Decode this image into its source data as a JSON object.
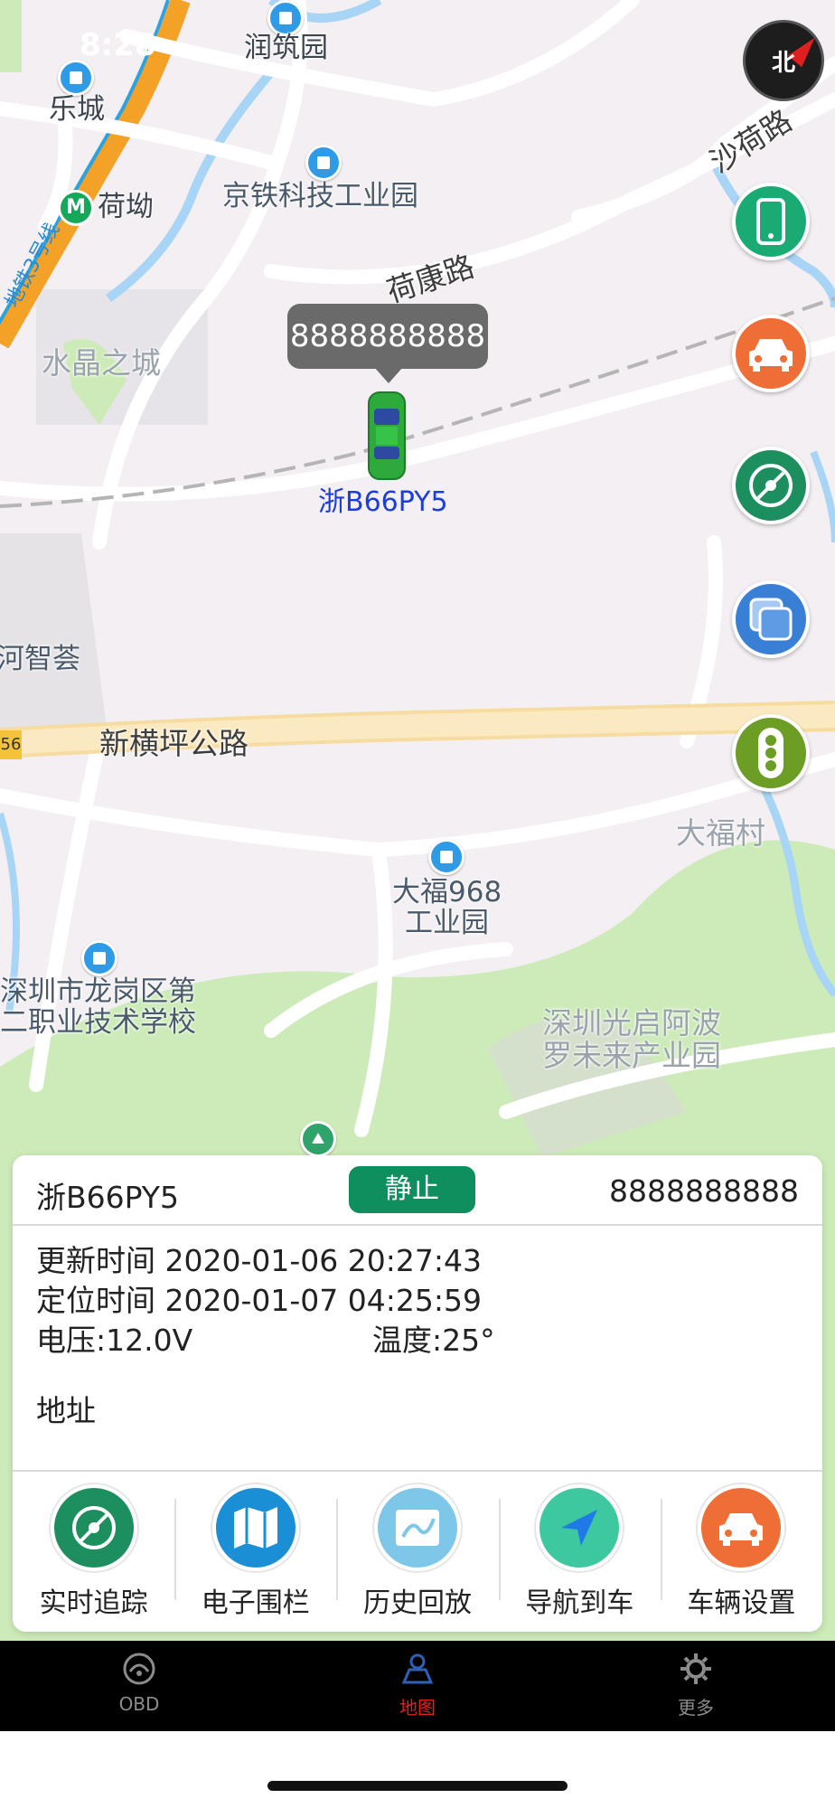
{
  "status_bar": {
    "time": "8:28"
  },
  "map": {
    "compass_label": "北",
    "labels": {
      "runzhu": "润筑园",
      "lecheng": "乐城",
      "heao": "荷坳",
      "jingtie": "京铁科技工业园",
      "shahe_road": "沙荷路",
      "hekang_road": "荷康路",
      "shuijing": "水晶之城",
      "hezhi": "河智荟",
      "xinhengping": "新横坪公路",
      "route_num": "56",
      "dafu_village": "大福村",
      "dafu968_1": "大福968",
      "dafu968_2": "工业园",
      "school_1": "深圳市龙岗区第",
      "school_2": "二职业技术学校",
      "guangqi_1": "深圳光启阿波",
      "guangqi_2": "罗未来产业园",
      "metro3": "地铁3号线"
    },
    "vehicle_bubble": "8888888888",
    "vehicle_plate": "浙B66PY5"
  },
  "side_buttons": [
    {
      "icon": "phone-icon",
      "color": "#1aaa74"
    },
    {
      "icon": "car-icon",
      "color": "#ef6e36"
    },
    {
      "icon": "compass-icon",
      "color": "#1d8f5f"
    },
    {
      "icon": "layers-icon",
      "color": "#3a7fd6"
    },
    {
      "icon": "traffic-light-icon",
      "color": "#6c9e25"
    }
  ],
  "info": {
    "plate": "浙B66PY5",
    "status": "静止",
    "device_id": "8888888888",
    "update_time": "更新时间 2020-01-06 20:27:43",
    "locate_time": "定位时间 2020-01-07 04:25:59",
    "voltage": "电压:12.0V",
    "temperature": "温度:25°",
    "address": "地址"
  },
  "actions": [
    {
      "label": "实时追踪",
      "icon": "tracking-icon",
      "color": "#1d8f5f"
    },
    {
      "label": "电子围栏",
      "icon": "map-fence-icon",
      "color": "#1a8fd6"
    },
    {
      "label": "历史回放",
      "icon": "history-playback-icon",
      "color": "#7fc7e8"
    },
    {
      "label": "导航到车",
      "icon": "navigation-icon",
      "color": "#3ec8a0"
    },
    {
      "label": "车辆设置",
      "icon": "car-settings-icon",
      "color": "#ef6e36"
    }
  ],
  "tabs": [
    {
      "label": "OBD",
      "icon": "obd-icon",
      "active": false
    },
    {
      "label": "地图",
      "icon": "map-user-icon",
      "active": true
    },
    {
      "label": "更多",
      "icon": "gear-icon",
      "active": false
    }
  ]
}
